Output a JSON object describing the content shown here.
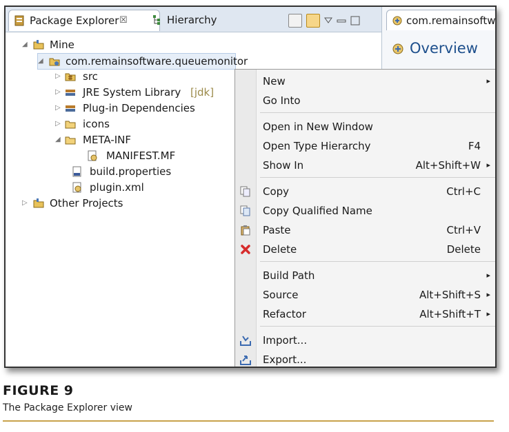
{
  "tabs": {
    "package_explorer": "Package Explorer",
    "close_glyph": "☒",
    "hierarchy": "Hierarchy"
  },
  "editor": {
    "tab_label": "com.remainsoftware",
    "heading": "Overview"
  },
  "tree": [
    {
      "label": "Mine",
      "suffix": "",
      "twisty": "◢",
      "icon": "working-set-icon"
    },
    {
      "label": "com.remainsoftware.queuemonitor",
      "suffix": "",
      "twisty": "◢",
      "icon": "plugin-project-icon"
    },
    {
      "label": "src",
      "suffix": "",
      "twisty": "▷",
      "icon": "source-folder-icon"
    },
    {
      "label": "JRE System Library",
      "suffix": "[jdk]",
      "twisty": "▷",
      "icon": "library-icon"
    },
    {
      "label": "Plug-in Dependencies",
      "suffix": "",
      "twisty": "▷",
      "icon": "library-icon"
    },
    {
      "label": "icons",
      "suffix": "",
      "twisty": "▷",
      "icon": "folder-icon"
    },
    {
      "label": "META-INF",
      "suffix": "",
      "twisty": "◢",
      "icon": "folder-icon"
    },
    {
      "label": "MANIFEST.MF",
      "suffix": "",
      "twisty": "",
      "icon": "manifest-file-icon"
    },
    {
      "label": "build.properties",
      "suffix": "",
      "twisty": "",
      "icon": "properties-file-icon"
    },
    {
      "label": "plugin.xml",
      "suffix": "",
      "twisty": "",
      "icon": "plugin-file-icon"
    },
    {
      "label": "Other Projects",
      "suffix": "",
      "twisty": "▷",
      "icon": "working-set-icon"
    }
  ],
  "context_menu": [
    {
      "label": "New",
      "shortcut": "",
      "submenu": "▸",
      "icon": ""
    },
    {
      "label": "Go Into",
      "shortcut": "",
      "submenu": "",
      "icon": ""
    },
    {
      "label": "Open in New Window",
      "shortcut": "",
      "submenu": "",
      "icon": ""
    },
    {
      "label": "Open Type Hierarchy",
      "shortcut": "F4",
      "submenu": "",
      "icon": ""
    },
    {
      "label": "Show In",
      "shortcut": "Alt+Shift+W",
      "submenu": "▸",
      "icon": ""
    },
    {
      "label": "Copy",
      "shortcut": "Ctrl+C",
      "submenu": "",
      "icon": "copy-icon"
    },
    {
      "label": "Copy Qualified Name",
      "shortcut": "",
      "submenu": "",
      "icon": "copy-qualified-name-icon"
    },
    {
      "label": "Paste",
      "shortcut": "Ctrl+V",
      "submenu": "",
      "icon": "paste-icon"
    },
    {
      "label": "Delete",
      "shortcut": "Delete",
      "submenu": "",
      "icon": "delete-icon"
    },
    {
      "label": "Build Path",
      "shortcut": "",
      "submenu": "▸",
      "icon": ""
    },
    {
      "label": "Source",
      "shortcut": "Alt+Shift+S",
      "submenu": "▸",
      "icon": ""
    },
    {
      "label": "Refactor",
      "shortcut": "Alt+Shift+T",
      "submenu": "▸",
      "icon": ""
    },
    {
      "label": "Import...",
      "shortcut": "",
      "submenu": "",
      "icon": "import-icon"
    },
    {
      "label": "Export...",
      "shortcut": "",
      "submenu": "",
      "icon": "export-icon"
    }
  ],
  "caption": {
    "figure": "FIGURE 9",
    "text": "The Package Explorer view"
  },
  "colors": {
    "accent_rule": "#c8a24a",
    "delete_red": "#d62b2b",
    "heading_blue": "#1d4f8c"
  }
}
